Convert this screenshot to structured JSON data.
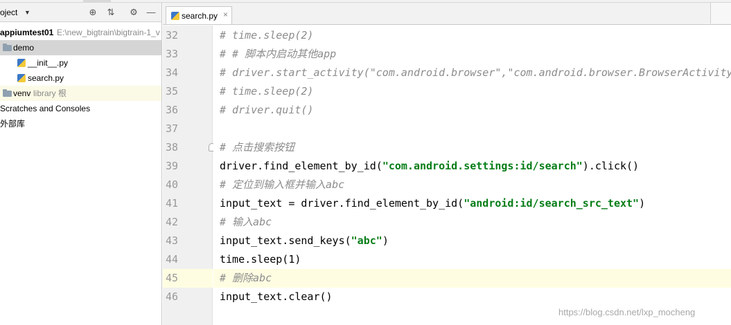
{
  "sidebar": {
    "title": "oject",
    "tree": [
      {
        "name": "appiumtest01",
        "path": "E:\\new_bigtrain\\bigtrain-1_v"
      },
      {
        "name": "demo"
      },
      {
        "name": "__init__.py"
      },
      {
        "name": "search.py"
      },
      {
        "name": "venv",
        "sub": "library 根"
      },
      {
        "name": "Scratches and Consoles"
      },
      {
        "name": "外部库"
      }
    ]
  },
  "editor": {
    "tab": "search.py",
    "lines": [
      {
        "n": "32",
        "text": "# time.sleep(2)"
      },
      {
        "n": "33",
        "text": "# # 脚本内启动其他app"
      },
      {
        "n": "34",
        "text": "# driver.start_activity(\"com.android.browser\",\"com.android.browser.BrowserActivity"
      },
      {
        "n": "35",
        "text": "# time.sleep(2)"
      },
      {
        "n": "36",
        "text": "# driver.quit()"
      },
      {
        "n": "37",
        "text": ""
      },
      {
        "n": "38",
        "text": "# 点击搜索按钮"
      },
      {
        "n": "39",
        "pre": "driver.find_element_by_id(",
        "str": "\"com.android.settings:id/search\"",
        "post": ").click()"
      },
      {
        "n": "40",
        "text": "# 定位到输入框并输入abc"
      },
      {
        "n": "41",
        "pre": "input_text = driver.find_element_by_id(",
        "str": "\"android:id/search_src_text\"",
        "post": ")"
      },
      {
        "n": "42",
        "text": "# 输入abc"
      },
      {
        "n": "43",
        "pre": "input_text.send_keys(",
        "str": "\"abc\"",
        "post": ")"
      },
      {
        "n": "44",
        "text": "time.sleep(1)"
      },
      {
        "n": "45",
        "text": "# 删除abc"
      },
      {
        "n": "46",
        "text": "input_text.clear()"
      }
    ]
  },
  "watermark": "https://blog.csdn.net/lxp_mocheng",
  "colors": {
    "comment": "#8c8c8c",
    "string": "#067d17",
    "current_line": "#fefde2"
  }
}
